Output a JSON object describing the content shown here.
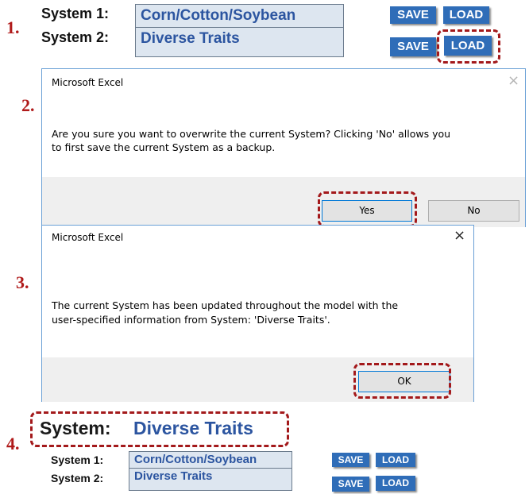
{
  "panel1": {
    "step": "1.",
    "system1_label": "System 1:",
    "system1_value": "Corn/Cotton/Soybean",
    "system2_label": "System 2:",
    "system2_value": "Diverse Traits",
    "save_label": "SAVE",
    "load_label": "LOAD"
  },
  "dialog1": {
    "step": "2.",
    "title": "Microsoft Excel",
    "close_glyph": "×",
    "message_line1": "Are you sure you want to overwrite the current System? Clicking 'No' allows you",
    "message_line2": "to first save the current System as a backup.",
    "yes_label": "Yes",
    "no_label": "No"
  },
  "dialog2": {
    "step": "3.",
    "title": "Microsoft Excel",
    "close_glyph": "×",
    "message_line1": "The current System has been updated throughout the model with the",
    "message_line2": "user-specified information from System: 'Diverse Traits'.",
    "ok_label": "OK"
  },
  "panel4": {
    "step": "4.",
    "system_label": "System:",
    "system_value": "Diverse Traits",
    "system1_label": "System 1:",
    "system1_value": "Corn/Cotton/Soybean",
    "system2_label": "System 2:",
    "system2_value": "Diverse Traits",
    "save_label": "SAVE",
    "load_label": "LOAD"
  },
  "colors": {
    "annotation_red": "#a3191b",
    "button_blue": "#2f6db8",
    "field_bg": "#dde6f0",
    "field_text": "#2c55a0"
  }
}
